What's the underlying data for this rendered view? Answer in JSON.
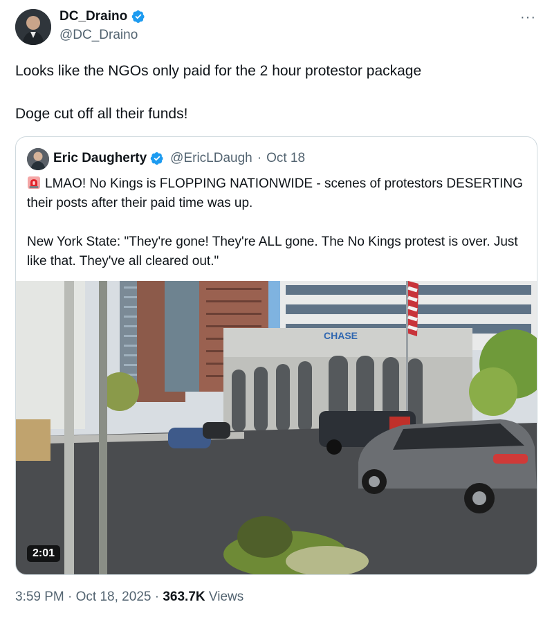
{
  "author": {
    "name": "DC_Draino",
    "handle": "@DC_Draino"
  },
  "tweet": {
    "line1": "Looks like the NGOs only paid for the 2 hour protestor package",
    "line2": "Doge cut off all their funds!"
  },
  "more_label": "···",
  "quote": {
    "name": "Eric Daugherty",
    "handle": "@EricLDaugh",
    "separator": "·",
    "date": "Oct 18",
    "para1": "LMAO! No Kings is FLOPPING NATIONWIDE - scenes of protestors DESERTING their posts after their paid time was up.",
    "para2": "New York State: \"They're gone! They're ALL gone. The No Kings protest is over. Just like that. They've all cleared out.\"",
    "video_duration": "2:01",
    "sign_text": "CHASE"
  },
  "footer": {
    "time": "3:59 PM",
    "dot": "·",
    "date": "Oct 18, 2025",
    "views_count": "363.7K",
    "views_label": "Views"
  },
  "colors": {
    "verified": "#1d9bf0",
    "muted": "#536471",
    "border": "#cfd9de"
  }
}
